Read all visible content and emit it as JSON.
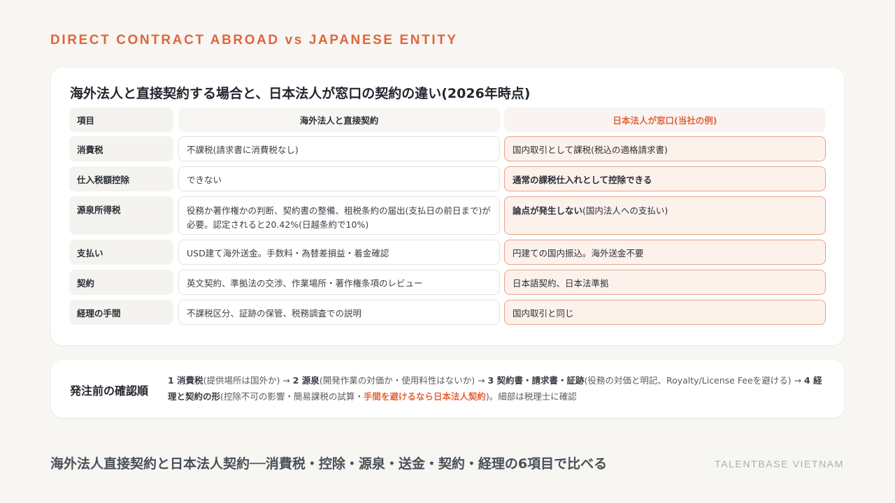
{
  "eyebrow": "DIRECT CONTRACT ABROAD vs JAPANESE ENTITY",
  "table": {
    "title": "海外法人と直接契約する場合と、日本法人が窓口の契約の違い(2026年時点)",
    "headers": {
      "item": "項目",
      "direct": "海外法人と直接契約",
      "japan": "日本法人が窓口(当社の例)"
    },
    "rows": [
      {
        "label": "消費税",
        "direct": "不課税(請求書に消費税なし)",
        "japan_bold": "",
        "japan": "国内取引として課税(税込の適格請求書)"
      },
      {
        "label": "仕入税額控除",
        "direct": "できない",
        "japan_bold": "通常の課税仕入れとして控除できる",
        "japan": ""
      },
      {
        "label": "源泉所得税",
        "direct": "役務か著作権かの判断、契約書の整備、租税条約の届出(支払日の前日まで)が必要。認定されると20.42%(日越条約で10%)",
        "japan_bold": "論点が発生しない",
        "japan": "(国内法人への支払い)"
      },
      {
        "label": "支払い",
        "direct": "USD建て海外送金。手数料・為替差損益・着金確認",
        "japan_bold": "",
        "japan": "円建ての国内振込。海外送金不要"
      },
      {
        "label": "契約",
        "direct": "英文契約、準拠法の交渉、作業場所・著作権条項のレビュー",
        "japan_bold": "",
        "japan": "日本語契約、日本法準拠"
      },
      {
        "label": "経理の手間",
        "direct": "不課税区分、証跡の保管、税務調査での説明",
        "japan_bold": "",
        "japan": "国内取引と同じ"
      }
    ]
  },
  "checklist": {
    "title": "発注前の確認順",
    "s1_bold": "1 消費税",
    "s1": "(提供場所は国外か) → ",
    "s2_bold": "2 源泉",
    "s2": "(開発作業の対価か・使用料性はないか) → ",
    "s3_bold": "3 契約書・請求書・証跡",
    "s3": "(役務の対価と明記、Royalty/License Feeを避ける) → ",
    "s4_bold": "4 経理と契約の形",
    "s4": "(控除不可の影響・簡易課税の試算・",
    "highlight": "手間を避けるなら日本法人契約",
    "tail": ")。細部は税理士に確認"
  },
  "footer": {
    "caption": "海外法人直接契約と日本法人契約──消費税・控除・源泉・送金・契約・経理の6項目で比べる",
    "brand": "TALENTBASE VIETNAM"
  },
  "colors": {
    "accent": "#e2643c",
    "background": "#f7f6f2",
    "card": "#ffffff",
    "highlight_cell": "#fdf1ec"
  }
}
